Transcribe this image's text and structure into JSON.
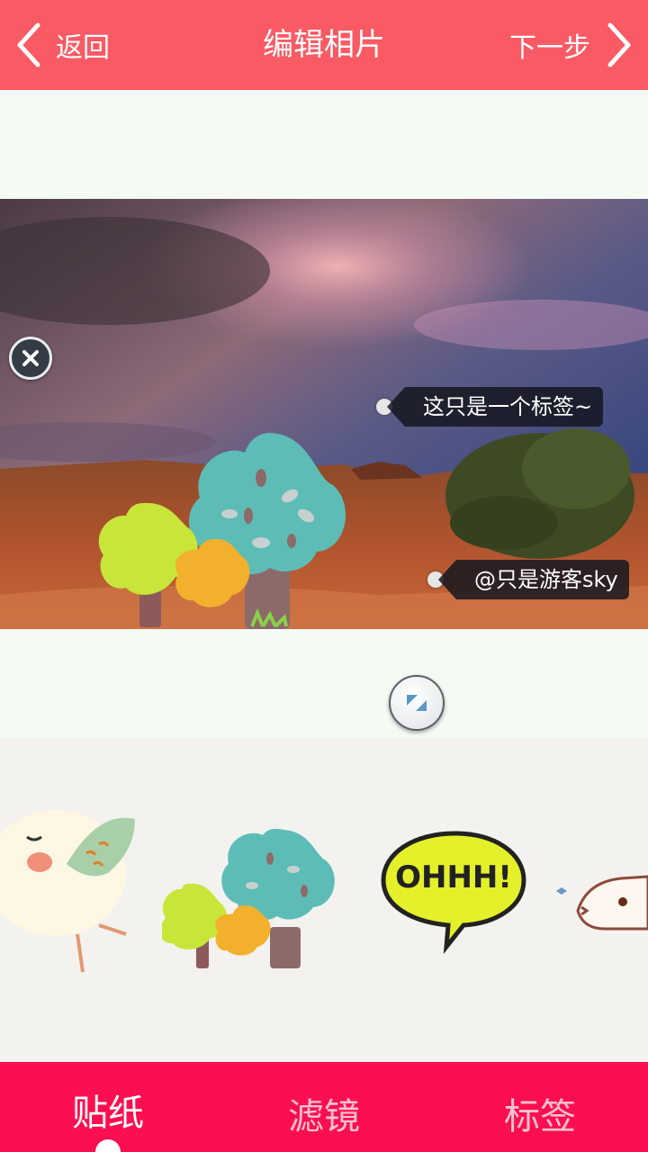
{
  "topbar": {
    "back_label": "返回",
    "title": "编辑相片",
    "next_label": "下一步",
    "background": "#fa5a64"
  },
  "canvas": {
    "tags": [
      {
        "text": "这只是一个标签~"
      },
      {
        "text": "@只是游客sky"
      }
    ],
    "controls": {
      "remove_icon": "close-x-icon",
      "rotate_icon": "rotate-scale-icon"
    }
  },
  "sticker_tray": {
    "stickers": [
      {
        "name": "bird-sticker"
      },
      {
        "name": "trees-sticker"
      },
      {
        "name": "ohhh-speech-bubble-sticker",
        "text": "OHHH!"
      },
      {
        "name": "cat-sticker"
      }
    ]
  },
  "bottom_nav": {
    "background": "#fc0f50",
    "tabs": [
      {
        "label": "贴纸",
        "active": true
      },
      {
        "label": "滤镜",
        "active": false
      },
      {
        "label": "标签",
        "active": false
      }
    ]
  }
}
